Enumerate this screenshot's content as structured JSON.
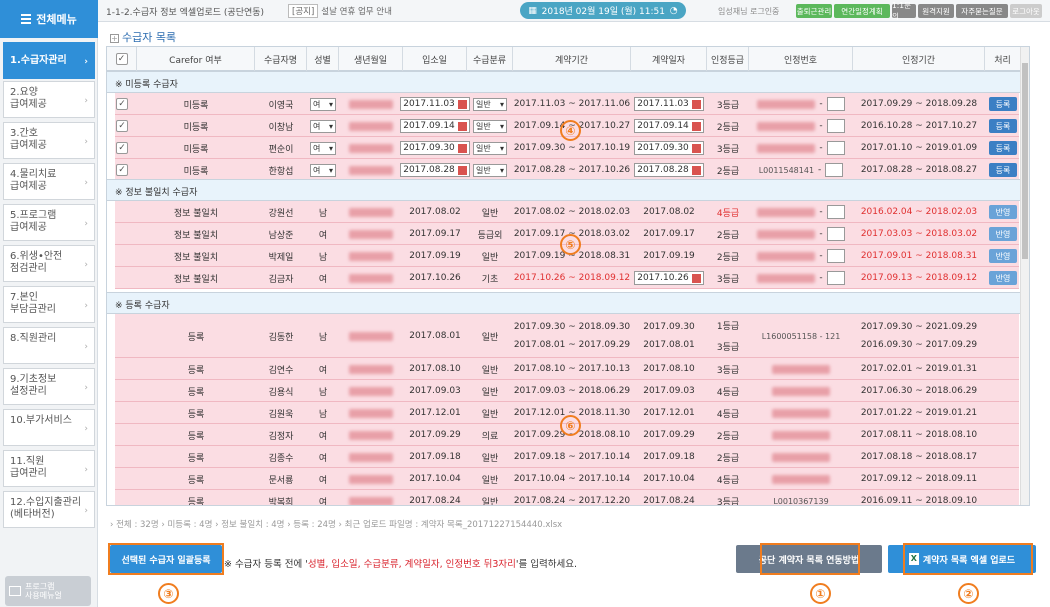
{
  "topbar": {
    "menu_label": "전체메뉴",
    "breadcrumb": "1-1-2.수급자 정보 엑셀업로드 (공단연동)",
    "notice_tag": "[공지]",
    "notice_text": "설날 연휴 업무 안내",
    "date": "2018년 02월 19일 (월) 11:51",
    "login_info": "임성재님 로그인중",
    "buttons": [
      "출퇴근관리",
      "연간일정계획",
      "1:1문의",
      "원격지원",
      "자주묻는질문",
      "로그아웃"
    ],
    "button_colors": [
      "#5cb85c",
      "#5cb85c",
      "#888888",
      "#888888",
      "#888888",
      "#cccccc"
    ]
  },
  "sidebar": {
    "items": [
      {
        "label": "1.수급자관리",
        "active": true
      },
      {
        "label": "2.요양\n급여제공"
      },
      {
        "label": "3.간호\n급여제공"
      },
      {
        "label": "4.물리치료\n급여제공"
      },
      {
        "label": "5.프로그램\n급여제공"
      },
      {
        "label": "6.위생•안전\n점검관리"
      },
      {
        "label": "7.본인\n부담금관리"
      },
      {
        "label": "8.직원관리"
      },
      {
        "label": "9.기초정보\n설정관리"
      },
      {
        "label": "10.부가서비스"
      },
      {
        "label": "11.직원\n급여관리"
      },
      {
        "label": "12.수입지출관리\n(베타버전)"
      }
    ],
    "program_label": "프로그램\n사용메뉴얼"
  },
  "main": {
    "title": "수급자 목록",
    "columns": [
      "",
      "Carefor 여부",
      "수급자명",
      "성별",
      "생년월일",
      "입소일",
      "수급분류",
      "계약기간",
      "계약일자",
      "인정등급",
      "인정번호",
      "인정기간",
      "처리"
    ],
    "sections": [
      {
        "title": "※ 미등록 수급자",
        "rows": [
          {
            "status": "미등록",
            "name": "이영국",
            "gender": "여",
            "admit": "2017.11.03",
            "cls": "일반",
            "period": "2017.11.03 ~ 2017.11.06",
            "cdate": "2017.11.03",
            "grade": "3등급",
            "lperiod": "2017.09.29 ~ 2018.09.28",
            "action": "등록"
          },
          {
            "status": "미등록",
            "name": "이창남",
            "gender": "여",
            "admit": "2017.09.14",
            "cls": "일반",
            "period": "2017.09.14 ~ 2017.10.27",
            "cdate": "2017.09.14",
            "grade": "2등급",
            "lperiod": "2016.10.28 ~ 2017.10.27",
            "action": "등록"
          },
          {
            "status": "미등록",
            "name": "편순이",
            "gender": "여",
            "admit": "2017.09.30",
            "cls": "일반",
            "period": "2017.09.30 ~ 2017.10.19",
            "cdate": "2017.09.30",
            "grade": "3등급",
            "lperiod": "2017.01.10 ~ 2019.01.09",
            "action": "등록"
          },
          {
            "status": "미등록",
            "name": "한항섭",
            "gender": "여",
            "admit": "2017.08.28",
            "cls": "일반",
            "period": "2017.08.28 ~ 2017.10.26",
            "cdate": "2017.08.28",
            "grade": "2등급",
            "lperiod": "2017.08.28 ~ 2018.08.27",
            "action": "등록",
            "lnum": "L0011548141"
          }
        ]
      },
      {
        "title": "※ 정보 불일치 수급자",
        "rows": [
          {
            "status": "정보 불일치",
            "name": "강원선",
            "gender": "남",
            "admit": "2017.08.02",
            "cls": "일반",
            "period": "2017.08.02 ~ 2018.02.03",
            "cdate": "2017.08.02",
            "grade": "4등급",
            "lperiod": "2016.02.04 ~ 2018.02.03",
            "action": "반영"
          },
          {
            "status": "정보 불일치",
            "name": "남상준",
            "gender": "여",
            "admit": "2017.09.17",
            "cls": "등급외",
            "period": "2017.09.17 ~ 2018.03.02",
            "cdate": "2017.09.17",
            "grade": "2등급",
            "lperiod": "2017.03.03 ~ 2018.03.02",
            "action": "반영"
          },
          {
            "status": "정보 불일치",
            "name": "박제일",
            "gender": "남",
            "admit": "2017.09.19",
            "cls": "일반",
            "period": "2017.09.19 ~ 2018.08.31",
            "cdate": "2017.09.19",
            "grade": "2등급",
            "lperiod": "2017.09.01 ~ 2018.08.31",
            "action": "반영"
          },
          {
            "status": "정보 불일치",
            "name": "김금자",
            "gender": "여",
            "admit": "2017.10.26",
            "cls": "기초",
            "period": "2017.10.26 ~ 2018.09.12",
            "cdate": "2017.10.26",
            "grade": "3등급",
            "lperiod": "2017.09.13 ~ 2018.09.12",
            "action": "반영"
          }
        ]
      },
      {
        "title": "※ 등록 수급자",
        "rows": [
          {
            "status": "등록",
            "name": "김동한",
            "gender": "남",
            "admit": "2017.08.01",
            "cls": "일반",
            "period": "2017.09.30 ~ 2018.09.30",
            "period2": "2017.08.01 ~ 2017.09.29",
            "cdate": "2017.09.30",
            "cdate2": "2017.08.01",
            "grade": "1등급",
            "grade2": "3등급",
            "lperiod": "2017.09.30 ~ 2021.09.29",
            "lperiod2": "2016.09.30 ~ 2017.09.29",
            "lnum": "L1600051158 - 121"
          },
          {
            "status": "등록",
            "name": "김연수",
            "gender": "여",
            "admit": "2017.08.10",
            "cls": "일반",
            "period": "2017.08.10 ~ 2017.10.13",
            "cdate": "2017.08.10",
            "grade": "3등급",
            "lperiod": "2017.02.01 ~ 2019.01.31"
          },
          {
            "status": "등록",
            "name": "김용식",
            "gender": "남",
            "admit": "2017.09.03",
            "cls": "일반",
            "period": "2017.09.03 ~ 2018.06.29",
            "cdate": "2017.09.03",
            "grade": "4등급",
            "lperiod": "2017.06.30 ~ 2018.06.29"
          },
          {
            "status": "등록",
            "name": "김원욱",
            "gender": "남",
            "admit": "2017.12.01",
            "cls": "일반",
            "period": "2017.12.01 ~ 2018.11.30",
            "cdate": "2017.12.01",
            "grade": "4등급",
            "lperiod": "2017.01.22 ~ 2019.01.21"
          },
          {
            "status": "등록",
            "name": "김정자",
            "gender": "여",
            "admit": "2017.09.29",
            "cls": "의료",
            "period": "2017.09.29 ~ 2018.08.10",
            "cdate": "2017.09.29",
            "grade": "2등급",
            "lperiod": "2017.08.11 ~ 2018.08.10"
          },
          {
            "status": "등록",
            "name": "김종수",
            "gender": "여",
            "admit": "2017.09.18",
            "cls": "일반",
            "period": "2017.09.18 ~ 2017.10.14",
            "cdate": "2017.09.18",
            "grade": "2등급",
            "lperiod": "2017.08.18 ~ 2018.08.17"
          },
          {
            "status": "등록",
            "name": "문서룡",
            "gender": "여",
            "admit": "2017.10.04",
            "cls": "일반",
            "period": "2017.10.04 ~ 2017.10.14",
            "cdate": "2017.10.04",
            "grade": "4등급",
            "lperiod": "2017.09.12 ~ 2018.09.11"
          },
          {
            "status": "등록",
            "name": "박복희",
            "gender": "여",
            "admit": "2017.08.24",
            "cls": "일반",
            "period": "2017.08.24 ~ 2017.12.20",
            "cdate": "2017.08.24",
            "grade": "3등급",
            "lperiod": "2016.09.11 ~ 2018.09.10",
            "lnum": "L0010367139"
          }
        ]
      }
    ],
    "footer": "› 전체 : 32명  › 미등록 : 4명  › 정보 불일치 : 4명  › 등록 : 24명  › 최근 업로드 파일명 : 계약자 목록_20171227154440.xlsx",
    "select_button": "선택된 수급자 일괄등록",
    "hint_prefix": "※ 수급자 등록 전에 '",
    "hint_highlight": "성별, 입소일, 수급분류, 계약일자, 인정번호 뒤3자리",
    "hint_suffix": "'를 입력하세요.",
    "link_button": "공단 계약자 목록 연동방법",
    "upload_button": "계약자 목록 엑셀 업로드",
    "annotations": [
      "①",
      "②",
      "③",
      "④",
      "⑤",
      "⑥"
    ]
  }
}
